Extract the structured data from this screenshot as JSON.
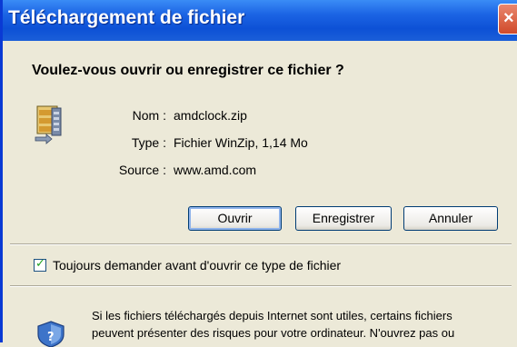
{
  "window": {
    "title": "Téléchargement de fichier",
    "close_glyph": "×"
  },
  "question": "Voulez-vous ouvrir ou enregistrer ce fichier ?",
  "file": {
    "icon": "winzip-file-icon",
    "name_label": "Nom :",
    "name_value": "amdclock.zip",
    "type_label": "Type :",
    "type_value": "Fichier WinZip, 1,14 Mo",
    "source_label": "Source :",
    "source_value": "www.amd.com"
  },
  "buttons": {
    "open": "Ouvrir",
    "save": "Enregistrer",
    "cancel": "Annuler"
  },
  "checkbox": {
    "checked": true,
    "label": "Toujours demander avant d'ouvrir ce type de fichier"
  },
  "warning": {
    "icon": "shield-icon",
    "line1": "Si les fichiers téléchargés depuis Internet sont utiles, certains fichiers",
    "line2": "peuvent présenter des risques pour votre ordinateur. N'ouvrez pas ou"
  },
  "colors": {
    "titlebar": "#0d51d6",
    "dialog_bg": "#ece9d8",
    "close_button": "#d04a2a"
  }
}
